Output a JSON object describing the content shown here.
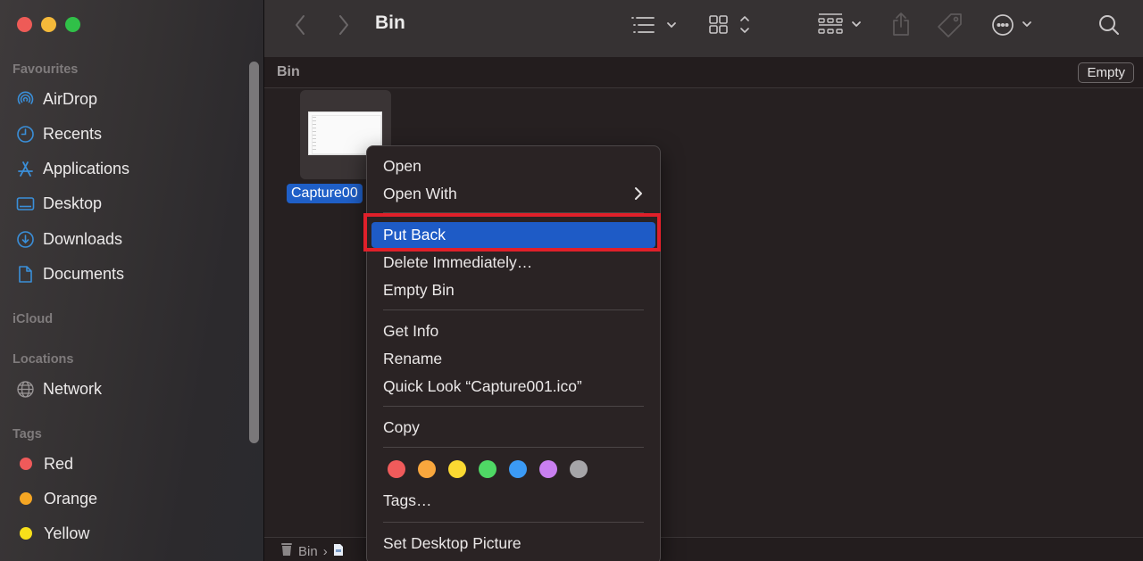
{
  "window": {
    "title": "Bin",
    "traffic_lights": [
      "close",
      "minimize",
      "zoom"
    ]
  },
  "sidebar": {
    "sections": [
      {
        "label": "Favourites",
        "items": [
          {
            "label": "AirDrop",
            "icon": "airdrop-icon"
          },
          {
            "label": "Recents",
            "icon": "clock-icon"
          },
          {
            "label": "Applications",
            "icon": "applications-icon"
          },
          {
            "label": "Desktop",
            "icon": "desktop-icon"
          },
          {
            "label": "Downloads",
            "icon": "download-icon"
          },
          {
            "label": "Documents",
            "icon": "document-icon"
          }
        ]
      },
      {
        "label": "iCloud",
        "items": []
      },
      {
        "label": "Locations",
        "items": [
          {
            "label": "Network",
            "icon": "globe-icon"
          }
        ]
      },
      {
        "label": "Tags",
        "items": [
          {
            "label": "Red",
            "color": "#ef5a5a"
          },
          {
            "label": "Orange",
            "color": "#f5a623"
          },
          {
            "label": "Yellow",
            "color": "#f7e01a"
          }
        ]
      }
    ]
  },
  "toolbar": {
    "back_icon": "chevron-left-icon",
    "forward_icon": "chevron-right-icon",
    "title": "Bin",
    "icons": [
      "list-view-icon",
      "icon-view-icon",
      "group-icon",
      "share-icon",
      "tag-icon",
      "more-icon",
      "search-icon"
    ]
  },
  "pathbar": {
    "title": "Bin",
    "empty_button": "Empty"
  },
  "content": {
    "files": [
      {
        "name": "Capture001.ico",
        "display_label": "Capture00",
        "selected": true
      }
    ]
  },
  "statusbar": {
    "path": [
      "Bin"
    ],
    "separator": "›"
  },
  "context_menu": {
    "items": [
      {
        "label": "Open"
      },
      {
        "label": "Open With",
        "submenu": true
      },
      {
        "label": "Put Back",
        "active": true,
        "highlighted_annotation": true
      },
      {
        "label": "Delete Immediately…"
      },
      {
        "label": "Empty Bin"
      },
      {
        "label": "Get Info"
      },
      {
        "label": "Rename"
      },
      {
        "label": "Quick Look “Capture001.ico”"
      },
      {
        "label": "Copy"
      },
      {
        "label": "Tags…"
      },
      {
        "label": "Set Desktop Picture"
      }
    ],
    "tag_colors": [
      {
        "name": "Red",
        "color": "#f05b5b"
      },
      {
        "name": "Orange",
        "color": "#f9a73d"
      },
      {
        "name": "Yellow",
        "color": "#fbd932"
      },
      {
        "name": "Green",
        "color": "#4fd865"
      },
      {
        "name": "Blue",
        "color": "#3b9af5"
      },
      {
        "name": "Purple",
        "color": "#c97ff0"
      },
      {
        "name": "Gray",
        "color": "#a6a5a8"
      }
    ]
  },
  "colors": {
    "accent": "#1e5bc6",
    "annotation": "#e0202a"
  }
}
